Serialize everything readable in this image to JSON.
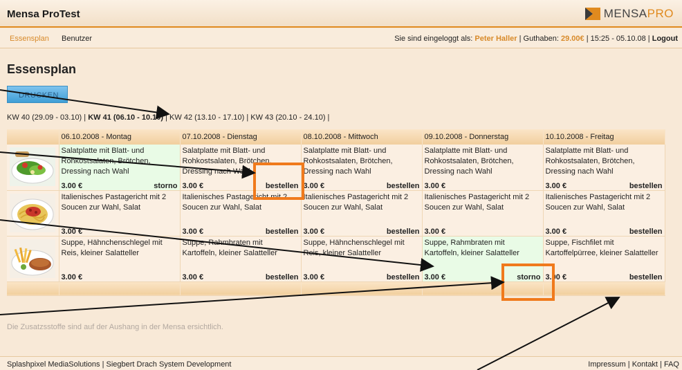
{
  "app": {
    "title": "Mensa ProTest",
    "logo_a": "MENSA",
    "logo_b": "PRO"
  },
  "nav": {
    "items": [
      "Essensplan",
      "Benutzer"
    ]
  },
  "user": {
    "label": "Sie sind eingeloggt als:",
    "name": "Peter Haller",
    "balance_label": "Guthaben:",
    "balance": "29.00€",
    "datetime": "15:25 - 05.10.08",
    "logout": "Logout"
  },
  "page": {
    "title": "Essensplan",
    "print_label": "DRUCKEN"
  },
  "weeks": [
    {
      "label": "KW 40 (29.09 - 03.10)"
    },
    {
      "label": "KW 41 (06.10 - 10.10)"
    },
    {
      "label": "KW 42 (13.10 - 17.10)"
    },
    {
      "label": "KW 43 (20.10 - 24.10)"
    }
  ],
  "days": [
    "06.10.2008 - Montag",
    "07.10.2008 - Dienstag",
    "08.10.2008 - Mittwoch",
    "09.10.2008 - Donnerstag",
    "10.10.2008 - Freitag"
  ],
  "meals": [
    {
      "image": "salad-plate-image",
      "cells": [
        {
          "desc": "Salatplatte mit Blatt- und Rohkostsalaten, Brötchen, Dressing nach Wahl",
          "price": "3.00 €",
          "action": "storno"
        },
        {
          "desc": "Salatplatte mit Blatt- und Rohkostsalaten, Brötchen, Dressing nach Wahl",
          "price": "3.00 €",
          "action": "bestellen"
        },
        {
          "desc": "Salatplatte mit Blatt- und Rohkostsalaten, Brötchen, Dressing nach Wahl",
          "price": "3.00 €",
          "action": "bestellen"
        },
        {
          "desc": "Salatplatte mit Blatt- und Rohkostsalaten, Brötchen, Dressing nach Wahl",
          "price": "3.00 €",
          "action": ""
        },
        {
          "desc": "Salatplatte mit Blatt- und Rohkostsalaten, Brötchen, Dressing nach Wahl",
          "price": "3.00 €",
          "action": "bestellen"
        }
      ]
    },
    {
      "image": "pasta-plate-image",
      "cells": [
        {
          "desc": "Italienisches Pastagericht mit 2 Soucen zur Wahl, Salat",
          "price": "3.00 €",
          "action": ""
        },
        {
          "desc": "Italienisches Pastagericht mit 2 Soucen zur Wahl, Salat",
          "price": "3.00 €",
          "action": "bestellen"
        },
        {
          "desc": "Italienisches Pastagericht mit 2 Soucen zur Wahl, Salat",
          "price": "3.00 €",
          "action": "bestellen"
        },
        {
          "desc": "Italienisches Pastagericht mit 2 Soucen zur Wahl, Salat",
          "price": "3.00 €",
          "action": ""
        },
        {
          "desc": "Italienisches Pastagericht mit 2 Soucen zur Wahl, Salat",
          "price": "3.00 €",
          "action": "bestellen"
        }
      ]
    },
    {
      "image": "schnitzel-fries-image",
      "cells": [
        {
          "desc": "Suppe, Hähnchenschlegel mit Reis, kleiner Salatteller",
          "price": "3.00 €",
          "action": ""
        },
        {
          "desc": "Suppe, Rahmbraten mit Kartoffeln, kleiner Salatteller",
          "price": "3.00 €",
          "action": "bestellen"
        },
        {
          "desc": "Suppe, Hähnchenschlegel mit Reis, kleiner Salatteller",
          "price": "3.00 €",
          "action": "bestellen"
        },
        {
          "desc": "Suppe, Rahmbraten mit Kartoffeln, kleiner Salatteller",
          "price": "3.00 €",
          "action": "storno"
        },
        {
          "desc": "Suppe, Fischfilet mit Kartoffelpürree, kleiner Salatteller",
          "price": "3.00 €",
          "action": "bestellen"
        }
      ]
    }
  ],
  "note": "Die Zusatzsstoffe sind auf der Aushang in der Mensa ersichtlich.",
  "footer": {
    "left": [
      "Splashpixel MediaSolutions",
      "Siegbert Drach System Development"
    ],
    "right": [
      "Impressum",
      "Kontakt",
      "FAQ"
    ]
  },
  "colors": {
    "accent": "#e08a1e",
    "highlight_box": "#f07a1c",
    "selected_cell": "#e9fbe6",
    "background": "#f8e9d7"
  }
}
